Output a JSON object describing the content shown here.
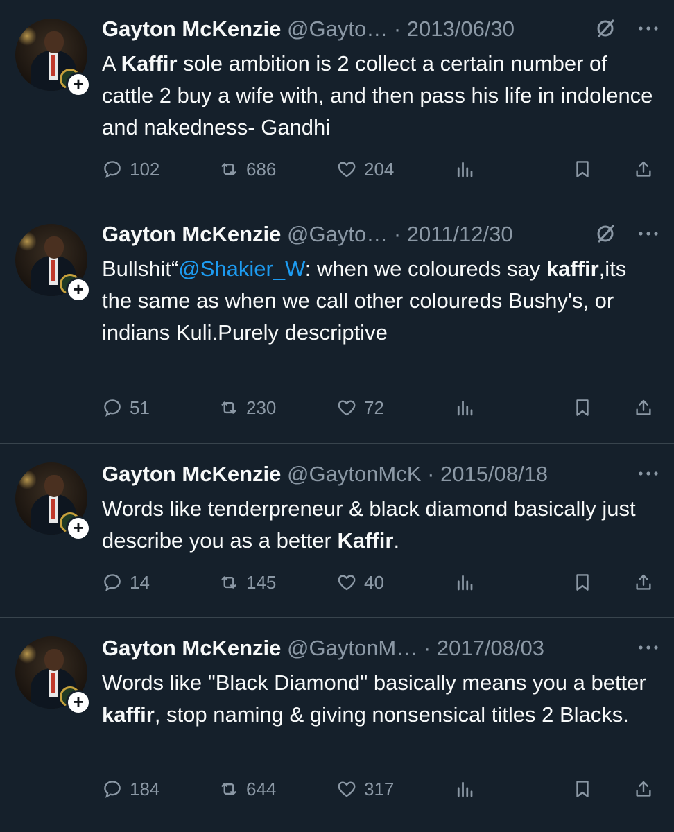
{
  "colors": {
    "background": "#15202b",
    "text": "#f7f9f9",
    "muted": "#8b98a5",
    "link": "#1d9bf0",
    "divider": "#38444d"
  },
  "icons": {
    "reply": "reply-icon",
    "retweet": "retweet-icon",
    "like": "heart-icon",
    "views": "analytics-icon",
    "bookmark": "bookmark-icon",
    "share": "share-icon",
    "grok": "grok-icon",
    "more": "more-icon",
    "follow": "follow-plus-icon"
  },
  "tweets": [
    {
      "name": "Gayton McKenzie",
      "handle": "@Gayto…",
      "sep": "·",
      "date": "2013/06/30",
      "follow_badge": "+",
      "text_parts": [
        "A ",
        "Kaffir",
        " sole ambition is 2 collect a certain number of cattle 2 buy a wife with, and then pass his life in indolence and nakedness- Gandhi"
      ],
      "replies": "102",
      "retweets": "686",
      "likes": "204"
    },
    {
      "name": "Gayton McKenzie",
      "handle": "@Gayto…",
      "sep": "·",
      "date": "2011/12/30",
      "follow_badge": "+",
      "text_parts": [
        "Bullshit“",
        "@Shakier_W",
        ": when we coloureds say ",
        "kaffir",
        ",its the same as when we call other coloureds Bushy's, or indians Kuli.Purely descriptive"
      ],
      "replies": "51",
      "retweets": "230",
      "likes": "72"
    },
    {
      "name": "Gayton McKenzie",
      "handle": "@GaytonMcK",
      "sep": "·",
      "date": "2015/08/18",
      "follow_badge": "+",
      "text_parts": [
        "Words like tenderpreneur & black diamond basically just describe you as a better ",
        "Kaffir",
        "."
      ],
      "replies": "14",
      "retweets": "145",
      "likes": "40"
    },
    {
      "name": "Gayton McKenzie",
      "handle": "@GaytonM…",
      "sep": "·",
      "date": "2017/08/03",
      "follow_badge": "+",
      "text_parts": [
        "Words like \"Black Diamond\"  basically means you a better ",
        "kaffir",
        ", stop naming & giving nonsensical titles 2 Blacks."
      ],
      "replies": "184",
      "retweets": "644",
      "likes": "317"
    }
  ]
}
